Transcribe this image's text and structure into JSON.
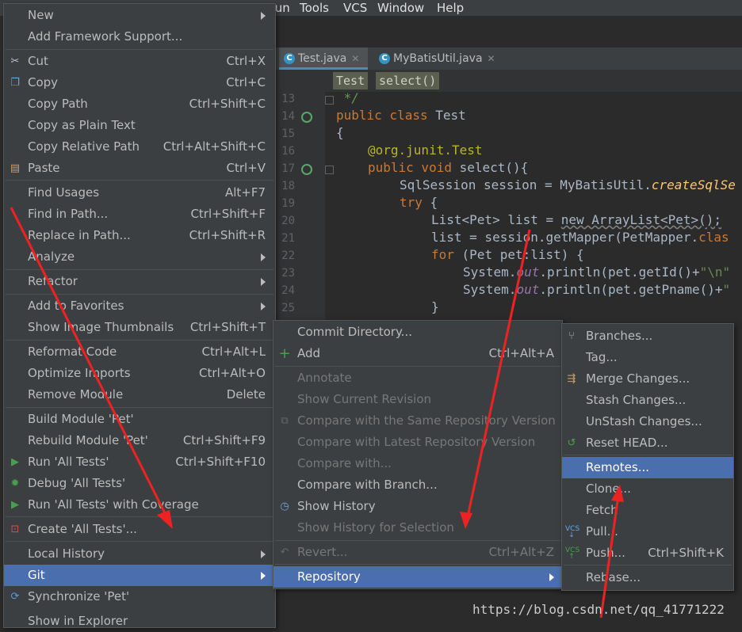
{
  "menubar": {
    "items": [
      "Tools",
      "VCS",
      "Window",
      "Help"
    ],
    "partial": "Run"
  },
  "tabs": [
    {
      "label": "Test.java",
      "icon": "class-icon"
    },
    {
      "label": "MyBatisUtil.java",
      "icon": "class-icon"
    }
  ],
  "breadcrumb": [
    "Test",
    "select()"
  ],
  "code": {
    "line_numbers": [
      "13",
      "14",
      "15",
      "16",
      "17",
      "18",
      "19",
      "20",
      "21",
      "22",
      "23",
      "24",
      "25"
    ],
    "l13": " */",
    "l14_kw": "public class ",
    "l14_name": "Test",
    "l15": "{",
    "l16_ann": "@org.junit.Test",
    "l17_kw": "public void ",
    "l17_rest": "select(){",
    "l18_a": "SqlSession session = MyBatisUtil.",
    "l18_it": "createSqlSe",
    "l19_kw": "try",
    "l19_rest": " {",
    "l20_a": "List<Pet> list = ",
    "l20_und": "new ArrayList<Pet>();",
    "l21_a": "list = session.getMapper(PetMapper.",
    "l21_kw": "clas",
    "l22_kw": "for",
    "l22_rest": " (Pet pet:list) {",
    "l23_a": "System.",
    "l23_f": "out",
    "l23_b": ".println(pet.getId()+",
    "l23_s": "\"\\n\"",
    "l24_a": "System.",
    "l24_f": "out",
    "l24_b": ".println(pet.getPname()+",
    "l24_s": "\"",
    "l25": "}"
  },
  "context_menu": {
    "items": [
      {
        "label": "New",
        "submenu": true
      },
      {
        "label": "Add Framework Support..."
      },
      {
        "label": "Cut",
        "shortcut": "Ctrl+X",
        "icon": "scissors-icon"
      },
      {
        "label": "Copy",
        "shortcut": "Ctrl+C",
        "icon": "copy-icon"
      },
      {
        "label": "Copy Path",
        "shortcut": "Ctrl+Shift+C"
      },
      {
        "label": "Copy as Plain Text"
      },
      {
        "label": "Copy Relative Path",
        "shortcut": "Ctrl+Alt+Shift+C"
      },
      {
        "label": "Paste",
        "shortcut": "Ctrl+V",
        "icon": "paste-icon"
      },
      {
        "label": "Find Usages",
        "shortcut": "Alt+F7"
      },
      {
        "label": "Find in Path...",
        "shortcut": "Ctrl+Shift+F"
      },
      {
        "label": "Replace in Path...",
        "shortcut": "Ctrl+Shift+R"
      },
      {
        "label": "Analyze",
        "submenu": true
      },
      {
        "label": "Refactor",
        "submenu": true
      },
      {
        "label": "Add to Favorites",
        "submenu": true
      },
      {
        "label": "Show Image Thumbnails",
        "shortcut": "Ctrl+Shift+T"
      },
      {
        "label": "Reformat Code",
        "shortcut": "Ctrl+Alt+L"
      },
      {
        "label": "Optimize Imports",
        "shortcut": "Ctrl+Alt+O"
      },
      {
        "label": "Remove Module",
        "shortcut": "Delete"
      },
      {
        "label": "Build Module 'Pet'"
      },
      {
        "label": "Rebuild Module 'Pet'",
        "shortcut": "Ctrl+Shift+F9"
      },
      {
        "label": "Run 'All Tests'",
        "shortcut": "Ctrl+Shift+F10",
        "icon": "run-icon"
      },
      {
        "label": "Debug 'All Tests'",
        "icon": "debug-icon"
      },
      {
        "label": "Run 'All Tests' with Coverage",
        "icon": "coverage-icon"
      },
      {
        "label": "Create 'All Tests'...",
        "icon": "create-config-icon"
      },
      {
        "label": "Local History",
        "submenu": true
      },
      {
        "label": "Git",
        "submenu": true,
        "selected": true
      },
      {
        "label": "Synchronize 'Pet'",
        "icon": "sync-icon"
      },
      {
        "label": "Show in Explorer"
      }
    ]
  },
  "git_menu": {
    "items": [
      {
        "label": "Commit Directory..."
      },
      {
        "label": "Add",
        "shortcut": "Ctrl+Alt+A",
        "icon": "plus-icon"
      },
      {
        "label": "Annotate",
        "disabled": true
      },
      {
        "label": "Show Current Revision",
        "disabled": true
      },
      {
        "label": "Compare with the Same Repository Version",
        "disabled": true,
        "icon": "compare-icon"
      },
      {
        "label": "Compare with Latest Repository Version",
        "disabled": true
      },
      {
        "label": "Compare with...",
        "disabled": true
      },
      {
        "label": "Compare with Branch..."
      },
      {
        "label": "Show History",
        "icon": "history-icon"
      },
      {
        "label": "Show History for Selection",
        "disabled": true
      },
      {
        "label": "Revert...",
        "shortcut": "Ctrl+Alt+Z",
        "disabled": true,
        "icon": "revert-icon"
      },
      {
        "label": "Repository",
        "submenu": true,
        "selected": true
      }
    ]
  },
  "repo_menu": {
    "items": [
      {
        "label": "Branches...",
        "icon": "branch-icon"
      },
      {
        "label": "Tag..."
      },
      {
        "label": "Merge Changes...",
        "icon": "merge-icon"
      },
      {
        "label": "Stash Changes..."
      },
      {
        "label": "UnStash Changes..."
      },
      {
        "label": "Reset HEAD...",
        "icon": "reset-icon"
      },
      {
        "label": "Remotes...",
        "selected": true
      },
      {
        "label": "Clone..."
      },
      {
        "label": "Fetch"
      },
      {
        "label": "Pull...",
        "icon": "vcs-pull-icon"
      },
      {
        "label": "Push...",
        "shortcut": "Ctrl+Shift+K",
        "icon": "vcs-push-icon"
      },
      {
        "label": "Rebase..."
      }
    ]
  },
  "watermark": "https://blog.csdn.net/qq_41771222",
  "colors": {
    "selection": "#4b6eaf",
    "menu_bg": "#3c3f41",
    "annotation_arrow": "#ee2222"
  }
}
